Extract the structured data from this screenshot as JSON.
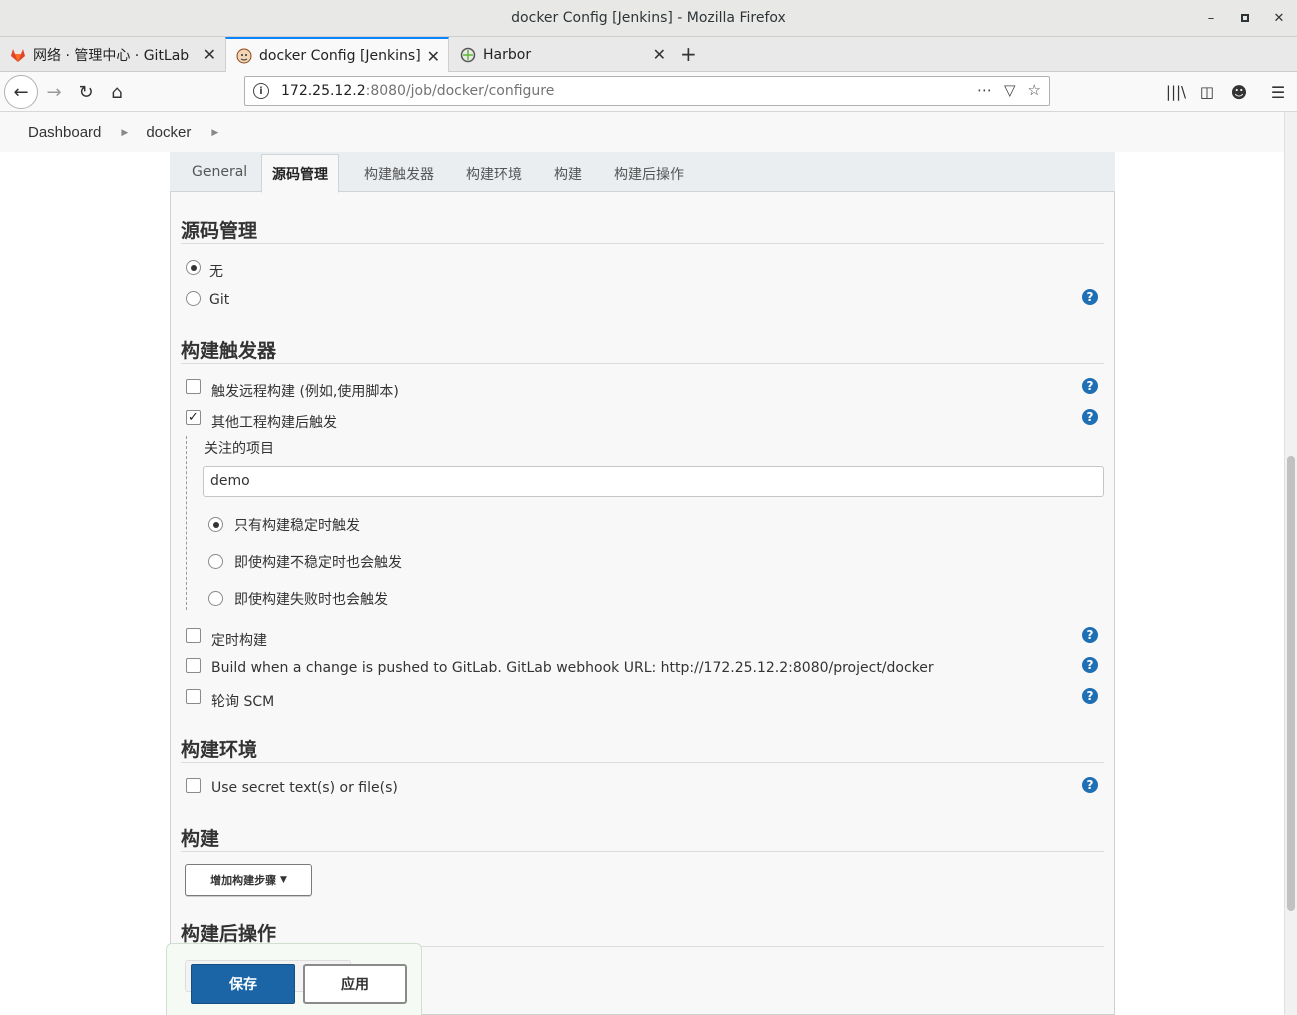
{
  "window": {
    "title": "docker Config [Jenkins] - Mozilla Firefox"
  },
  "browser_tabs": [
    {
      "label": "网络 · 管理中心 · GitLab"
    },
    {
      "label": "docker Config [Jenkins]"
    },
    {
      "label": "Harbor"
    }
  ],
  "address": {
    "host": "172.25.12.2",
    "path": ":8080/job/docker/configure"
  },
  "breadcrumb": [
    "Dashboard",
    "docker"
  ],
  "config_tabs": [
    "General",
    "源码管理",
    "构建触发器",
    "构建环境",
    "构建",
    "构建后操作"
  ],
  "scm": {
    "title": "源码管理",
    "options": [
      {
        "label": "无",
        "selected": true
      },
      {
        "label": "Git",
        "selected": false
      }
    ]
  },
  "triggers": {
    "title": "构建触发器",
    "remote": {
      "label": "触发远程构建 (例如,使用脚本)",
      "checked": false
    },
    "upstream": {
      "label": "其他工程构建后触发",
      "checked": true
    },
    "watched_label": "关注的项目",
    "watched_value": "demo",
    "conditions": [
      {
        "label": "只有构建稳定时触发",
        "selected": true
      },
      {
        "label": "即使构建不稳定时也会触发",
        "selected": false
      },
      {
        "label": "即使构建失败时也会触发",
        "selected": false
      }
    ],
    "timer": {
      "label": "定时构建",
      "checked": false
    },
    "gitlab": {
      "label": "Build when a change is pushed to GitLab. GitLab webhook URL: http://172.25.12.2:8080/project/docker",
      "checked": false
    },
    "poll": {
      "label": "轮询 SCM",
      "checked": false
    }
  },
  "env": {
    "title": "构建环境",
    "secret": {
      "label": "Use secret text(s) or file(s)",
      "checked": false
    }
  },
  "build": {
    "title": "构建",
    "add_step": "增加构建步骤"
  },
  "post": {
    "title": "构建后操作"
  },
  "actions": {
    "save": "保存",
    "apply": "应用"
  }
}
